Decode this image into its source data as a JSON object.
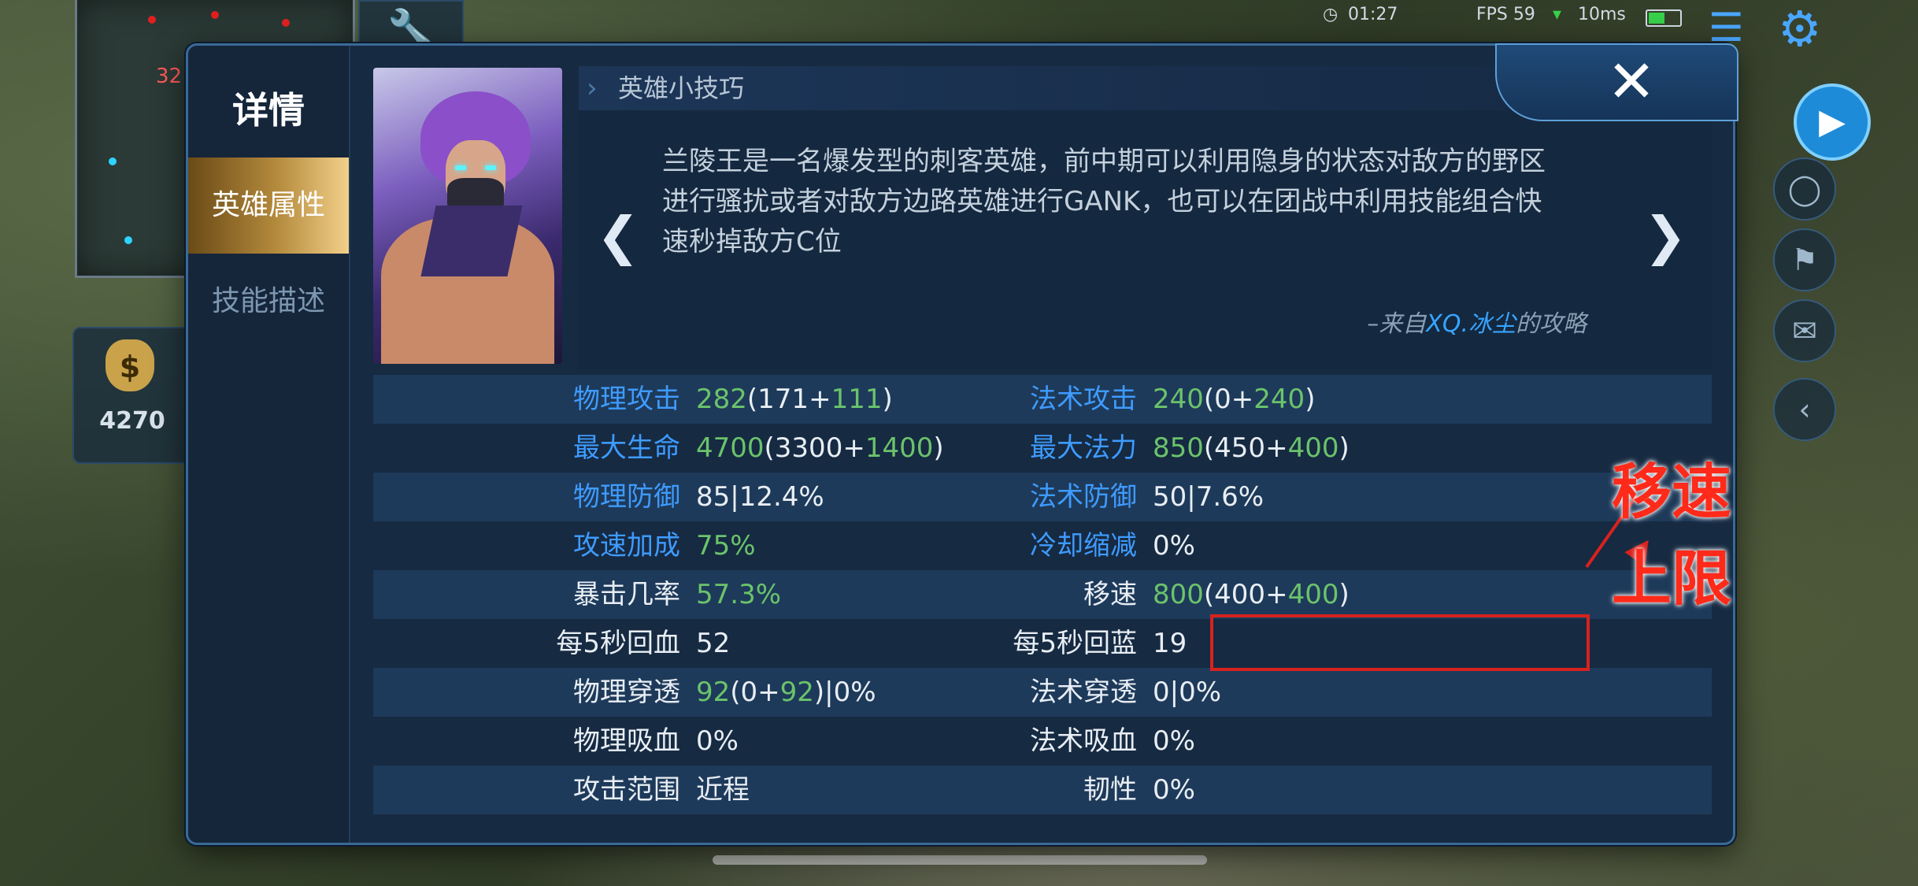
{
  "hud": {
    "minimap_level": "32",
    "gold": "4270",
    "time": "01:27",
    "fps": "FPS 59",
    "ping": "10ms"
  },
  "sidebar": {
    "title": "详情",
    "tabs": [
      "英雄属性",
      "技能描述"
    ],
    "active_tab": 0
  },
  "tips": {
    "header": "英雄小技巧",
    "text": "兰陵王是一名爆发型的刺客英雄，前中期可以利用隐身的状态对敌方的野区进行骚扰或者对敌方边路英雄进行GANK，也可以在团战中利用技能组合快速秒掉敌方C位",
    "source_prefix": "–来自",
    "source_author": "XQ.冰尘",
    "source_suffix": "的攻略"
  },
  "stats": [
    {
      "l1": "物理攻击",
      "v1": [
        [
          "282",
          "g"
        ],
        [
          "(171+",
          "w"
        ],
        [
          "111",
          "g"
        ],
        [
          ")",
          "w"
        ]
      ],
      "l2": "法术攻击",
      "v2": [
        [
          "240",
          "g"
        ],
        [
          "(0+",
          "w"
        ],
        [
          "240",
          "g"
        ],
        [
          ")",
          "w"
        ]
      ],
      "blue": true
    },
    {
      "l1": "最大生命",
      "v1": [
        [
          "4700",
          "g"
        ],
        [
          "(3300+",
          "w"
        ],
        [
          "1400",
          "g"
        ],
        [
          ")",
          "w"
        ]
      ],
      "l2": "最大法力",
      "v2": [
        [
          "850",
          "g"
        ],
        [
          "(450+",
          "w"
        ],
        [
          "400",
          "g"
        ],
        [
          ")",
          "w"
        ]
      ],
      "blue": true
    },
    {
      "l1": "物理防御",
      "v1": [
        [
          "85|12.4%",
          "w"
        ]
      ],
      "l2": "法术防御",
      "v2": [
        [
          "50|7.6%",
          "w"
        ]
      ],
      "blue": true
    },
    {
      "l1": "攻速加成",
      "v1": [
        [
          "75%",
          "g"
        ]
      ],
      "l2": "冷却缩减",
      "v2": [
        [
          "0%",
          "w"
        ]
      ],
      "blue": true
    },
    {
      "l1": "暴击几率",
      "v1": [
        [
          "57.3%",
          "g"
        ]
      ],
      "l2": "移速",
      "v2": [
        [
          "800",
          "g"
        ],
        [
          "(400+",
          "w"
        ],
        [
          "400",
          "g"
        ],
        [
          ")",
          "w"
        ]
      ],
      "blue": false
    },
    {
      "l1": "每5秒回血",
      "v1": [
        [
          "52",
          "w"
        ]
      ],
      "l2": "每5秒回蓝",
      "v2": [
        [
          "19",
          "w"
        ]
      ],
      "blue": false
    },
    {
      "l1": "物理穿透",
      "v1": [
        [
          "92",
          "g"
        ],
        [
          "(0+",
          "w"
        ],
        [
          "92",
          "g"
        ],
        [
          ")|0%",
          "w"
        ]
      ],
      "l2": "法术穿透",
      "v2": [
        [
          "0|0%",
          "w"
        ]
      ],
      "blue": false
    },
    {
      "l1": "物理吸血",
      "v1": [
        [
          "0%",
          "w"
        ]
      ],
      "l2": "法术吸血",
      "v2": [
        [
          "0%",
          "w"
        ]
      ],
      "blue": false
    },
    {
      "l1": "攻击范围",
      "v1": [
        [
          "近程",
          "w"
        ]
      ],
      "l2": "韧性",
      "v2": [
        [
          "0%",
          "w"
        ]
      ],
      "blue": false
    }
  ],
  "annotation": {
    "text": "移速上限",
    "color": "#d8221e"
  },
  "colors": {
    "label_blue": "#3e9bff",
    "value_green": "#6bc36b",
    "panel_bg": "#162a42",
    "active_tab_gold": "#b48a3c"
  },
  "icons": {
    "close": "close-icon",
    "prev": "chevron-left-icon",
    "next": "chevron-right-icon",
    "gold": "money-bag-icon",
    "settings": "gear-icon",
    "record": "video-camera-icon"
  }
}
